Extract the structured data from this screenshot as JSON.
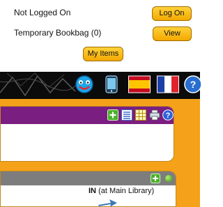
{
  "account": {
    "login_status": "Not Logged On",
    "login_button": "Log On",
    "bookbag_text": "Temporary Bookbag (0)",
    "view_button": "View",
    "my_items_button": "My Items"
  },
  "toolbar": {
    "icons": [
      "smiley-icon",
      "phone-icon",
      "spain-flag-icon",
      "france-flag-icon",
      "help-globe-icon"
    ]
  },
  "search_panel": {
    "icons": [
      "add-icon",
      "list-icon",
      "grid-icon",
      "print-icon",
      "help-icon"
    ]
  },
  "record_panel": {
    "icons": [
      "add-icon",
      "status-dot"
    ],
    "availability_status": "IN",
    "availability_location": "(at Main Library)"
  },
  "colors": {
    "button_gradient_top": "#ffd23a",
    "button_gradient_bottom": "#f3a800",
    "page_accent": "#f5a21a",
    "search_header": "#7b1e81",
    "record_header": "#7d7d7d"
  }
}
